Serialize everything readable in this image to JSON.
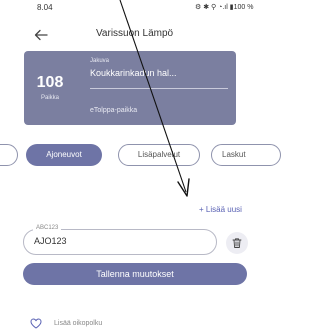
{
  "status_bar": {
    "time": "8.04",
    "icons": "⚙ ✱ ⚲ ◔.ıl ▮100 %",
    "battery": "100 %"
  },
  "header": {
    "title": "Varissuon Lämpö"
  },
  "card": {
    "spot_count": "108",
    "spot_caption": "Paikka",
    "small_label": "Jakuva",
    "location_name": "Koukkarinkadun hal...",
    "footer": "eTolppa-paikka"
  },
  "tabs": [
    {
      "label": ""
    },
    {
      "label": "Ajoneuvot",
      "active": true
    },
    {
      "label": "Lisäpalvelut"
    },
    {
      "label": "Laskut"
    }
  ],
  "actions": {
    "add_new": "+ Lisää uusi",
    "save": "Tallenna muutokset"
  },
  "plate": {
    "label": "ABC123",
    "value": "AJO123"
  },
  "favorite": {
    "label": "Lisää oikopolku"
  },
  "colors": {
    "primary": "#6e74a6",
    "card": "#7b7fa0",
    "link": "#5a62b4"
  },
  "icons": {
    "back": "arrow-left-icon",
    "delete": "trash-icon",
    "favorite": "heart-icon"
  }
}
